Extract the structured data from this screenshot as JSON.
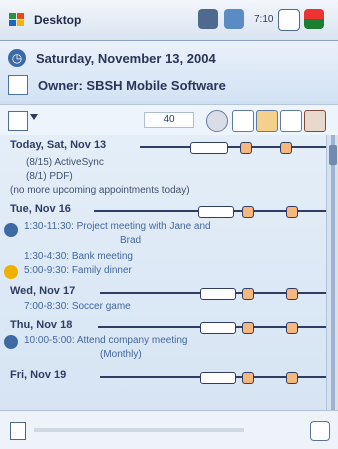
{
  "topbar": {
    "title": "Desktop",
    "time": "7:10"
  },
  "header": {
    "date": "Saturday, November 13, 2004",
    "owner": "Owner: SBSH Mobile Software"
  },
  "toolbar": {
    "zoom": "40"
  },
  "schedule": {
    "days": [
      {
        "label": "Today, Sat, Nov 13",
        "items": [
          {
            "text": "(8/15) ActiveSync"
          },
          {
            "text": "(8/1) PDF)"
          },
          {
            "text": "(no more upcoming appointments today)"
          }
        ]
      },
      {
        "label": "Tue, Nov 16",
        "items": [
          {
            "text": "1:30-11:30: Project meeting with Jane and",
            "cont": "Brad"
          },
          {
            "text": "1:30-4:30: Bank meeting"
          },
          {
            "text": "5:00-9:30: Family dinner"
          }
        ]
      },
      {
        "label": "Wed, Nov 17",
        "items": [
          {
            "text": "7:00-8:30: Soccer game"
          }
        ]
      },
      {
        "label": "Thu, Nov 18",
        "items": [
          {
            "text": "10:00-5:00: Attend company meeting",
            "cont": "(Monthly)"
          }
        ]
      },
      {
        "label": "Fri, Nov 19",
        "items": []
      }
    ]
  }
}
